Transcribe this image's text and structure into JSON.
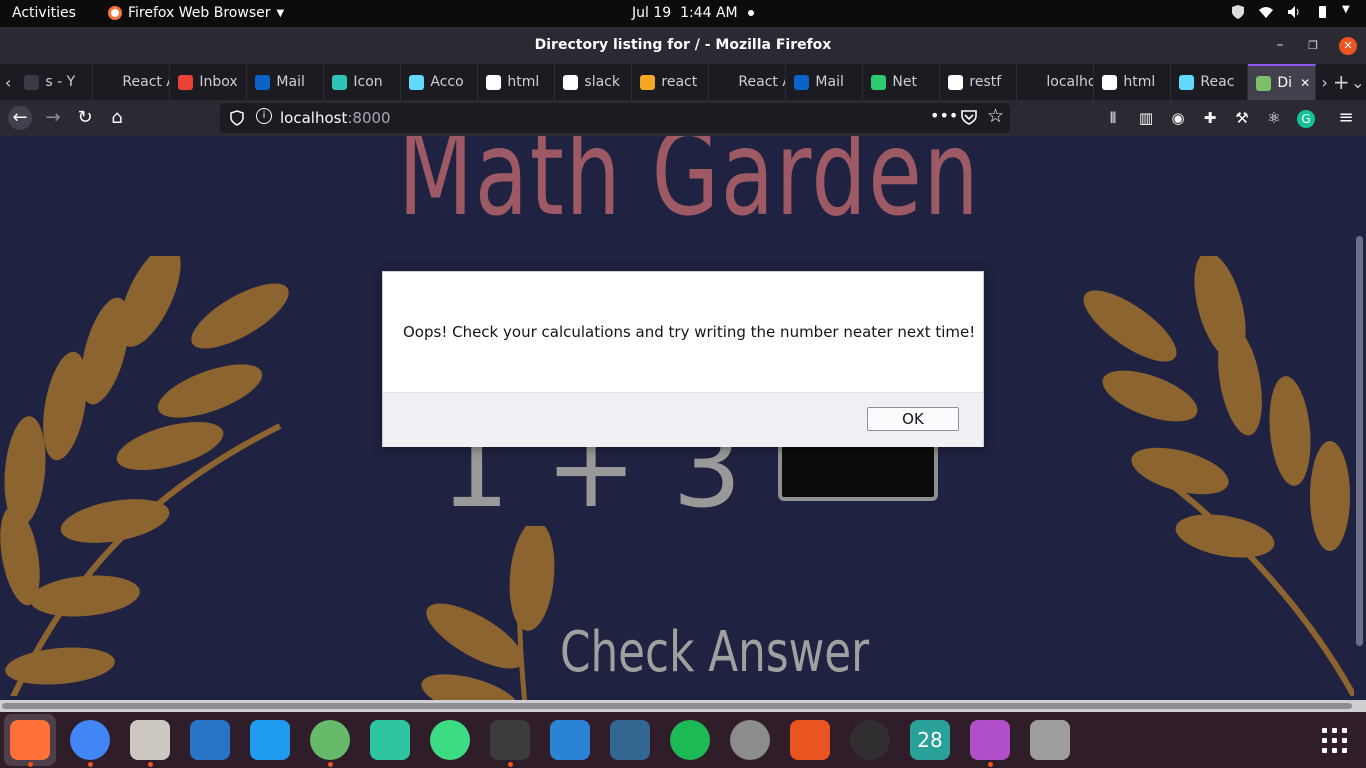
{
  "topbar": {
    "activities": "Activities",
    "app_name": "Firefox Web Browser",
    "date": "Jul 19",
    "time": "1:44 AM"
  },
  "window": {
    "title": "Directory listing for / - Mozilla Firefox"
  },
  "tabs": [
    {
      "label": "s - Y",
      "color": "#3a3944"
    },
    {
      "label": "React A",
      "color": "#1c1b22"
    },
    {
      "label": "Inbox",
      "color": "#ea4335"
    },
    {
      "label": "Mail",
      "color": "#0a64c8"
    },
    {
      "label": "Icon",
      "color": "#2ec4b6"
    },
    {
      "label": "Acco",
      "color": "#61dafb"
    },
    {
      "label": "html",
      "color": "#ffffff"
    },
    {
      "label": "slack",
      "color": "#ffffff"
    },
    {
      "label": "react",
      "color": "#f5a623"
    },
    {
      "label": "React A",
      "color": "#1c1b22"
    },
    {
      "label": "Mail",
      "color": "#0a64c8"
    },
    {
      "label": "Net",
      "color": "#2ecc71"
    },
    {
      "label": "restf",
      "color": "#ffffff"
    },
    {
      "label": "localhos",
      "color": "#1c1b22"
    },
    {
      "label": "html",
      "color": "#ffffff"
    },
    {
      "label": "Reac",
      "color": "#61dafb"
    },
    {
      "label": "Di",
      "color": "#7fbf6a",
      "active": true
    }
  ],
  "navbar": {
    "url_host": "localhost",
    "url_port": ":8000"
  },
  "page": {
    "title": "Math Garden",
    "equation": "1 + 3",
    "check_answer": "Check Answer"
  },
  "dialog": {
    "message": "Oops! Check your calculations and try writing the number neater next time!",
    "ok_label": "OK"
  },
  "dock": {
    "calendar_day": "28",
    "apps": [
      {
        "name": "firefox",
        "color": "#ff7139",
        "running": true
      },
      {
        "name": "chrome",
        "color": "#4285f4",
        "running": true
      },
      {
        "name": "files",
        "color": "#cdc8c0",
        "running": true
      },
      {
        "name": "thunderbird",
        "color": "#2a74c8",
        "running": false
      },
      {
        "name": "vscode",
        "color": "#1f9cf0",
        "running": false
      },
      {
        "name": "atom",
        "color": "#66bb6a",
        "running": true
      },
      {
        "name": "vscodium",
        "color": "#2fc5a0",
        "running": false
      },
      {
        "name": "android-studio",
        "color": "#3ddc84",
        "running": false
      },
      {
        "name": "terminal",
        "color": "#3c3c3c",
        "running": true
      },
      {
        "name": "libreoffice-writer",
        "color": "#2b83d6",
        "running": false
      },
      {
        "name": "pgadmin",
        "color": "#336791",
        "running": false
      },
      {
        "name": "spotify",
        "color": "#1db954",
        "running": false
      },
      {
        "name": "vpn",
        "color": "#8c8c8c",
        "running": false
      },
      {
        "name": "software-center",
        "color": "#e95420",
        "running": false
      },
      {
        "name": "obs",
        "color": "#302e31",
        "running": false
      },
      {
        "name": "calendar",
        "color": "#2aa198",
        "running": false
      },
      {
        "name": "video",
        "color": "#b14fc9",
        "running": true
      },
      {
        "name": "usb",
        "color": "#9e9e9e",
        "running": false
      }
    ]
  }
}
